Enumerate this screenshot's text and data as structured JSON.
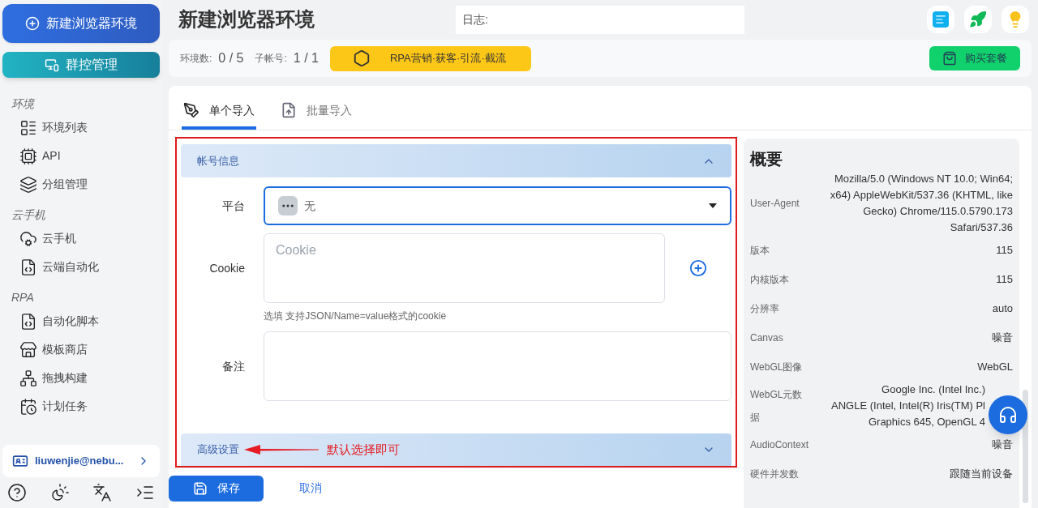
{
  "sidebar": {
    "new_button": "新建浏览器环境",
    "group_button": "群控管理",
    "sections": [
      {
        "title": "环境",
        "items": [
          {
            "label": "环境列表",
            "kind": "list"
          },
          {
            "label": "API",
            "kind": "api"
          },
          {
            "label": "分组管理",
            "kind": "layers"
          }
        ]
      },
      {
        "title": "云手机",
        "items": [
          {
            "label": "云手机",
            "kind": "cloud"
          },
          {
            "label": "云端自动化",
            "kind": "script"
          }
        ]
      },
      {
        "title": "RPA",
        "items": [
          {
            "label": "自动化脚本",
            "kind": "script"
          },
          {
            "label": "模板商店",
            "kind": "store"
          },
          {
            "label": "拖拽构建",
            "kind": "network"
          },
          {
            "label": "计划任务",
            "kind": "calendar"
          }
        ]
      }
    ],
    "user": "liuwenjie@nebu..."
  },
  "header": {
    "title": "新建浏览器环境",
    "log_label": "日志:"
  },
  "stats": {
    "env_label": "环境数:",
    "env_value": "0 / 5",
    "sub_label": "子帐号:",
    "sub_value": "1 / 1",
    "promo": "RPA营销·获客·引流·截流",
    "buy": "购买套餐"
  },
  "tabs": [
    {
      "label": "单个导入",
      "selected": true,
      "kind": "single"
    },
    {
      "label": "批量导入",
      "selected": false,
      "kind": "batch"
    }
  ],
  "form": {
    "section": "帐号信息",
    "expanded": true,
    "platform_label": "平台",
    "platform_value": "无",
    "cookie_label": "Cookie",
    "cookie_placeholder": "Cookie",
    "cookie_hint": "选填 支持JSON/Name=value格式的cookie",
    "note_label": "备注",
    "advanced": "高级设置",
    "advanced_expanded": false,
    "annotation": "默认选择即可"
  },
  "actions": {
    "save": "保存",
    "cancel": "取消"
  },
  "summary": {
    "title": "概要",
    "rows": [
      {
        "label": "User-Agent",
        "lines": [
          "Mozilla/5.0 (Windows NT 10.0; Win64;",
          "x64) AppleWebKit/537.36 (KHTML, like",
          "Gecko) Chrome/115.0.5790.173",
          "Safari/537.36"
        ]
      },
      {
        "label": "版本",
        "lines": [
          "115"
        ]
      },
      {
        "label": "内核版本",
        "lines": [
          "115"
        ]
      },
      {
        "label": "分辨率",
        "lines": [
          "auto"
        ]
      },
      {
        "label": "Canvas",
        "lines": [
          "噪音"
        ]
      },
      {
        "label": "WebGL图像",
        "lines": [
          "WebGL"
        ]
      },
      {
        "label": "WebGL元数据",
        "lines": [
          "Google Inc. (Intel Inc.)",
          "ANGLE (Intel, Intel(R) Iris(TM) Pl",
          "Graphics 645, OpenGL 4"
        ],
        "kind": "covered"
      },
      {
        "label": "AudioContext",
        "lines": [
          "噪音"
        ]
      },
      {
        "label": "硬件并发数",
        "lines": [
          "跟随当前设备"
        ]
      }
    ]
  }
}
